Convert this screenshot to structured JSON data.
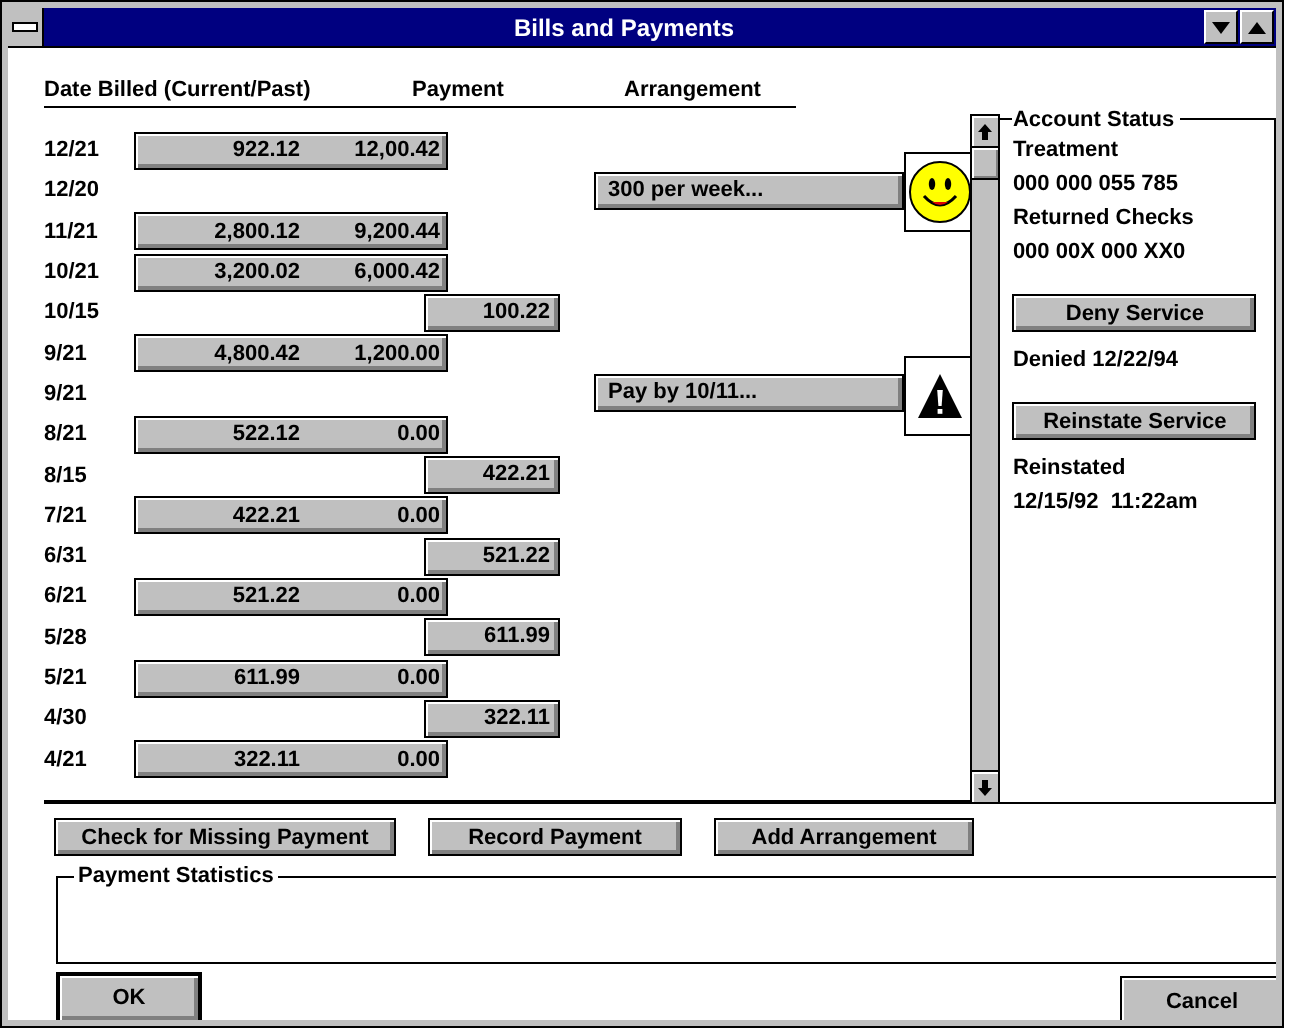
{
  "window": {
    "title": "Bills and Payments"
  },
  "columns": [
    "Date Billed (Current/Past)",
    "Payment",
    "Arrangement"
  ],
  "rows": [
    {
      "kind": "bill",
      "date": "12/21",
      "current": "922.12",
      "past": "12,00.42"
    },
    {
      "kind": "arrangement",
      "date": "12/20",
      "label": "300 per week...",
      "indicator": {
        "kind": "smiley"
      }
    },
    {
      "kind": "bill",
      "date": "11/21",
      "current": "2,800.12",
      "past": "9,200.44"
    },
    {
      "kind": "bill",
      "date": "10/21",
      "current": "3,200.02",
      "past": "6,000.42"
    },
    {
      "kind": "payment",
      "date": "10/15",
      "amount": "100.22"
    },
    {
      "kind": "bill",
      "date": "9/21",
      "current": "4,800.42",
      "past": "1,200.00"
    },
    {
      "kind": "arrangement",
      "date": "9/21",
      "label": "Pay by 10/11...",
      "indicator": {
        "kind": "warning"
      }
    },
    {
      "kind": "bill",
      "date": "8/21",
      "current": "522.12",
      "past": "0.00"
    },
    {
      "kind": "payment",
      "date": "8/15",
      "amount": "422.21"
    },
    {
      "kind": "bill",
      "date": "7/21",
      "current": "422.21",
      "past": "0.00"
    },
    {
      "kind": "payment",
      "date": "6/31",
      "amount": "521.22"
    },
    {
      "kind": "bill",
      "date": "6/21",
      "current": "521.22",
      "past": "0.00"
    },
    {
      "kind": "payment",
      "date": "5/28",
      "amount": "611.99"
    },
    {
      "kind": "bill",
      "date": "5/21",
      "current": "611.99",
      "past": "0.00"
    },
    {
      "kind": "payment",
      "date": "4/30",
      "amount": "322.11"
    },
    {
      "kind": "bill",
      "date": "4/21",
      "current": "322.11",
      "past": "0.00"
    }
  ],
  "account_status": {
    "title": "Account Status",
    "items": [
      {
        "kind": "text",
        "text": "Treatment"
      },
      {
        "kind": "text",
        "text": "000 000 055 785"
      },
      {
        "kind": "text",
        "text": "Returned Checks"
      },
      {
        "kind": "text",
        "text": "000 00X 000 XX0"
      },
      {
        "kind": "button",
        "text": "Deny Service"
      },
      {
        "kind": "text",
        "text": "Denied 12/22/94"
      },
      {
        "kind": "button",
        "text": "Reinstate Service"
      },
      {
        "kind": "text",
        "text": "Reinstated"
      },
      {
        "kind": "text",
        "text": "12/15/92  11:22am"
      }
    ]
  },
  "actions": [
    "Check for Missing Payment",
    "Record Payment",
    "Add Arrangement"
  ],
  "payment_statistics": {
    "title": "Payment Statistics"
  },
  "ok_button": "OK",
  "cancel_button": "Cancel"
}
